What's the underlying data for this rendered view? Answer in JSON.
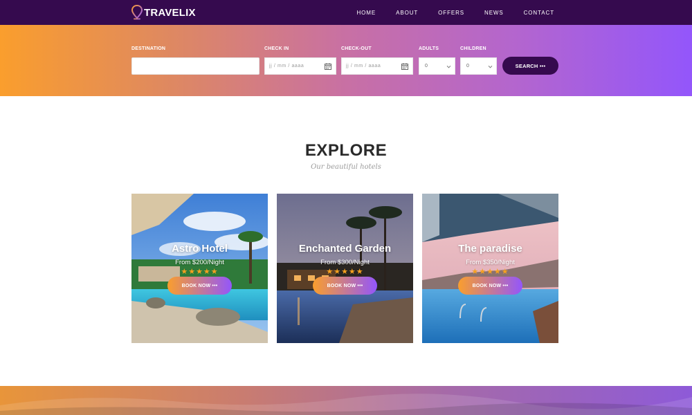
{
  "brand": {
    "name": "TRAVELIX"
  },
  "nav": [
    "HOME",
    "ABOUT",
    "OFFERS",
    "NEWS",
    "CONTACT"
  ],
  "search": {
    "destination_label": "DESTINATION",
    "destination_value": "",
    "checkin_label": "CHECK IN",
    "checkin_placeholder": "jj / mm / aaaa",
    "checkout_label": "CHECK-OUT",
    "checkout_placeholder": "jj / mm / aaaa",
    "adults_label": "ADULTS",
    "adults_value": "0",
    "children_label": "CHILDREN",
    "children_value": "0",
    "button_label": "SEARCH •••"
  },
  "explore": {
    "title": "EXPLORE",
    "subtitle": "Our beautiful hotels"
  },
  "hotels": [
    {
      "name": "Astro Hotel",
      "price": "From $200/Night",
      "stars": "★★★★★",
      "button": "BOOK NOW •••"
    },
    {
      "name": "Enchanted Garden",
      "price": "From $300/Night",
      "stars": "★★★★★",
      "button": "BOOK NOW •••"
    },
    {
      "name": "The paradise",
      "price": "From $350/Night",
      "stars": "★★★★★",
      "button": "BOOK NOW •••"
    }
  ],
  "colors": {
    "header": "#350a4e",
    "gradient_start": "#fa9e2d",
    "gradient_end": "#9356fb",
    "star": "#f6a11f"
  }
}
